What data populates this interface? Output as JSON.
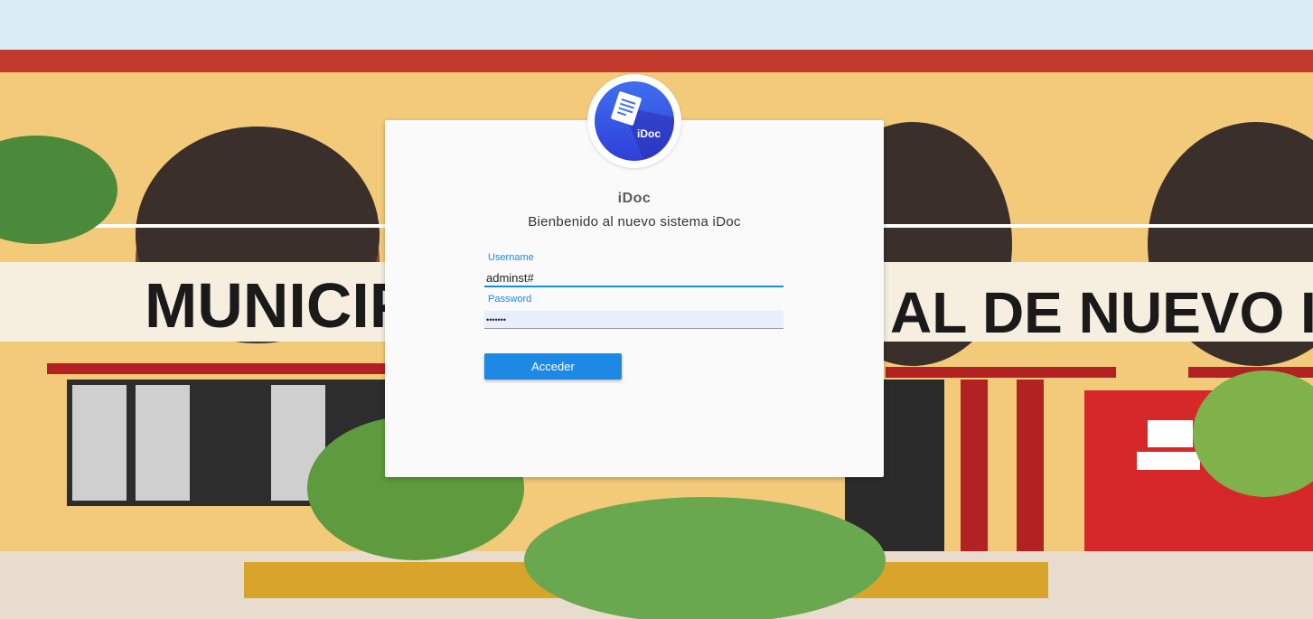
{
  "background": {
    "building_sign_left": "MUNICIP",
    "building_sign_right": "AL DE NUEVO I"
  },
  "logo": {
    "text": "iDoc",
    "icon": "document-icon",
    "color": "#3355e6"
  },
  "login": {
    "app_title": "iDoc",
    "welcome": "Bienbenido al nuevo sistema iDoc",
    "username_label": "Username",
    "username_value": "adminst#",
    "password_label": "Password",
    "password_value": "•••••••",
    "submit_label": "Acceder"
  },
  "colors": {
    "accent": "#1e88e5"
  }
}
